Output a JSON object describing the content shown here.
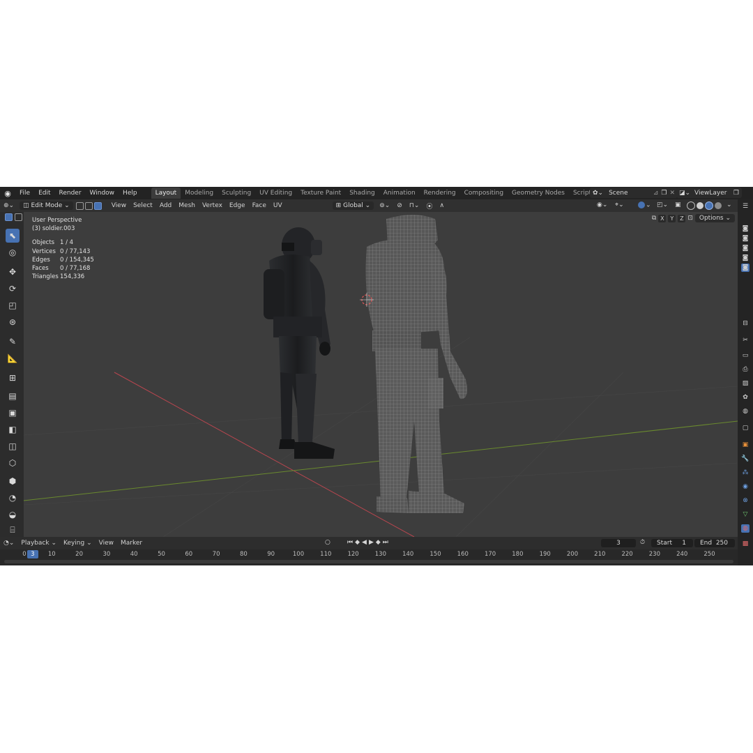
{
  "menu": [
    "File",
    "Edit",
    "Render",
    "Window",
    "Help"
  ],
  "workspaces": [
    "Layout",
    "Modeling",
    "Sculpting",
    "UV Editing",
    "Texture Paint",
    "Shading",
    "Animation",
    "Rendering",
    "Compositing",
    "Geometry Nodes",
    "Scripting"
  ],
  "add_tab": "+",
  "scene": "Scene",
  "view_layer": "ViewLayer",
  "header": {
    "mode": "Edit Mode",
    "menus": [
      "View",
      "Select",
      "Add",
      "Mesh",
      "Vertex",
      "Edge",
      "Face",
      "UV"
    ],
    "transform": "Global"
  },
  "viewport": {
    "perspective": "User Perspective",
    "object": "(3) soldier.003",
    "stats": [
      {
        "label": "Objects",
        "value": "1 / 4"
      },
      {
        "label": "Vertices",
        "value": "0 / 77,143"
      },
      {
        "label": "Edges",
        "value": "0 / 154,345"
      },
      {
        "label": "Faces",
        "value": "0 / 77,168"
      },
      {
        "label": "Triangles",
        "value": "154,336"
      }
    ],
    "axes": [
      "X",
      "Y",
      "Z"
    ],
    "options": "Options"
  },
  "timeline": {
    "menus": [
      "Playback",
      "Keying",
      "View",
      "Marker"
    ],
    "current_frame": "3",
    "start_label": "Start",
    "start": "1",
    "end_label": "End",
    "end": "250",
    "ticks": [
      "0",
      "10",
      "20",
      "30",
      "40",
      "50",
      "60",
      "70",
      "80",
      "90",
      "100",
      "110",
      "120",
      "130",
      "140",
      "150",
      "160",
      "170",
      "180",
      "190",
      "200",
      "210",
      "220",
      "230",
      "240",
      "250"
    ]
  },
  "colors": {
    "accent": "#4772b3",
    "viewport_bg": "#3d3d3d",
    "x_axis": "#b8464f",
    "y_axis": "#6a8a2e"
  }
}
